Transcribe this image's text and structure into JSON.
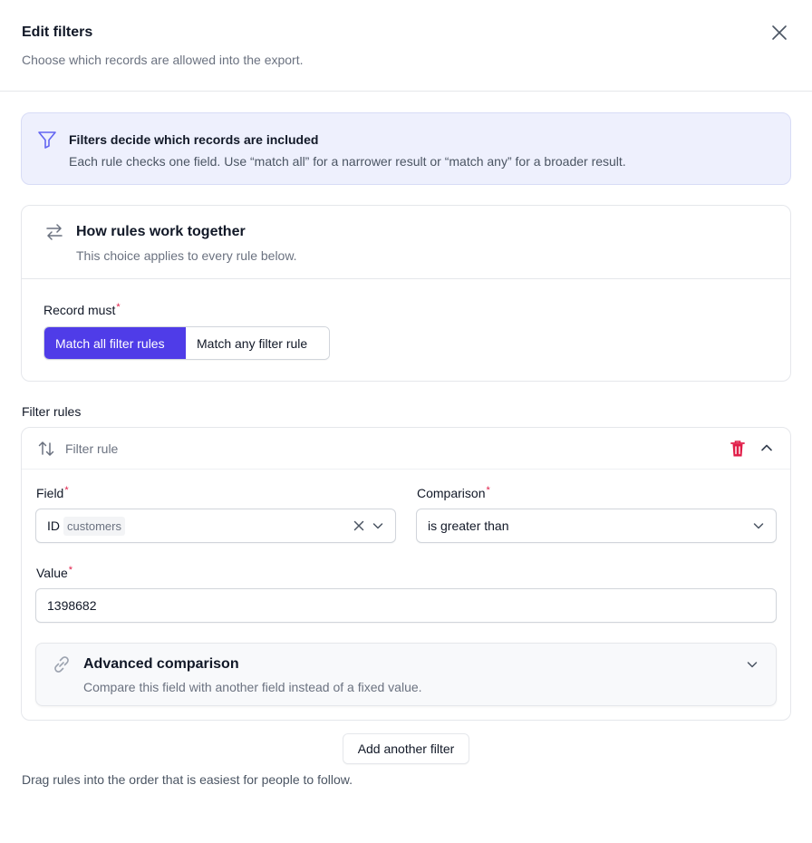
{
  "header": {
    "title": "Edit filters",
    "subtitle": "Choose which records are allowed into the export.",
    "close_icon": "close-icon"
  },
  "info": {
    "icon": "funnel-icon",
    "title": "Filters decide which records are included",
    "text": "Each rule checks one field. Use “match all” for a narrower result or “match any” for a broader result."
  },
  "logic": {
    "icon": "swap-arrows-icon",
    "title": "How rules work together",
    "subtitle": "This choice applies to every rule below.",
    "record_label": "Record must",
    "required_mark": "*",
    "options": [
      {
        "label": "Match all filter rules",
        "selected": true
      },
      {
        "label": "Match any filter rule",
        "selected": false
      }
    ]
  },
  "rules": {
    "section_label": "Filter rules",
    "rule": {
      "head_label": "Filter rule",
      "field_label": "Field",
      "field_value": "ID",
      "field_tag": "customers",
      "comparison_label": "Comparison",
      "comparison_value": "is greater than",
      "value_label": "Value",
      "value": "1398682",
      "advanced_title": "Advanced comparison",
      "advanced_sub": "Compare this field with another field instead of a fixed value."
    },
    "add_button": "Add another filter",
    "footer_note": "Drag rules into the order that is easiest for people to follow."
  },
  "colors": {
    "accent": "#4f3ce8",
    "danger": "#e11d48",
    "info_bg": "#eef0fd",
    "info_icon": "#6366f1"
  }
}
